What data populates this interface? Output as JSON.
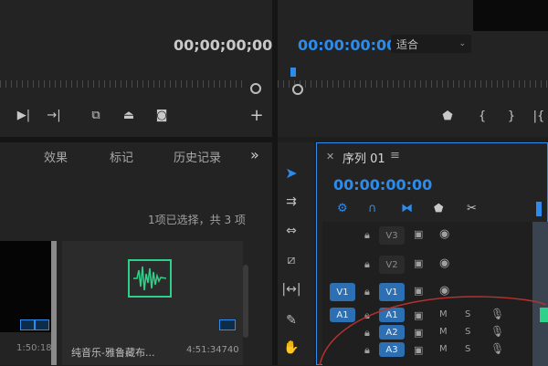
{
  "source_monitor": {
    "timecode": "00;00;00;00"
  },
  "program_monitor": {
    "timecode": "00:00:00:00",
    "fit_label": "适合"
  },
  "project_panel": {
    "tabs": [
      "效果",
      "标记",
      "历史记录"
    ],
    "overflow": "»",
    "selection_info": "1项已选择，共 3 项",
    "items": [
      {
        "name": "",
        "duration": "1:50:18"
      },
      {
        "name": "纯音乐-雅鲁藏布...",
        "duration": "4:51:34740"
      }
    ]
  },
  "timeline": {
    "title": "序列 01",
    "menu": "≡",
    "timecode": "00:00:00:00",
    "video_tracks": [
      {
        "label": "V3",
        "source": ""
      },
      {
        "label": "V2",
        "source": ""
      },
      {
        "label": "V1",
        "source": "V1"
      }
    ],
    "audio_tracks": [
      {
        "label": "A1",
        "source": "A1",
        "m": "M",
        "s": "S"
      },
      {
        "label": "A2",
        "source": "",
        "m": "M",
        "s": "S"
      },
      {
        "label": "A3",
        "source": "",
        "m": "M",
        "s": "S"
      }
    ]
  },
  "colors": {
    "accent": "#2d8ceb",
    "track_blue": "#2c6fb3",
    "clip_green": "#2fd18a",
    "annotation_red": "#b5312f"
  }
}
